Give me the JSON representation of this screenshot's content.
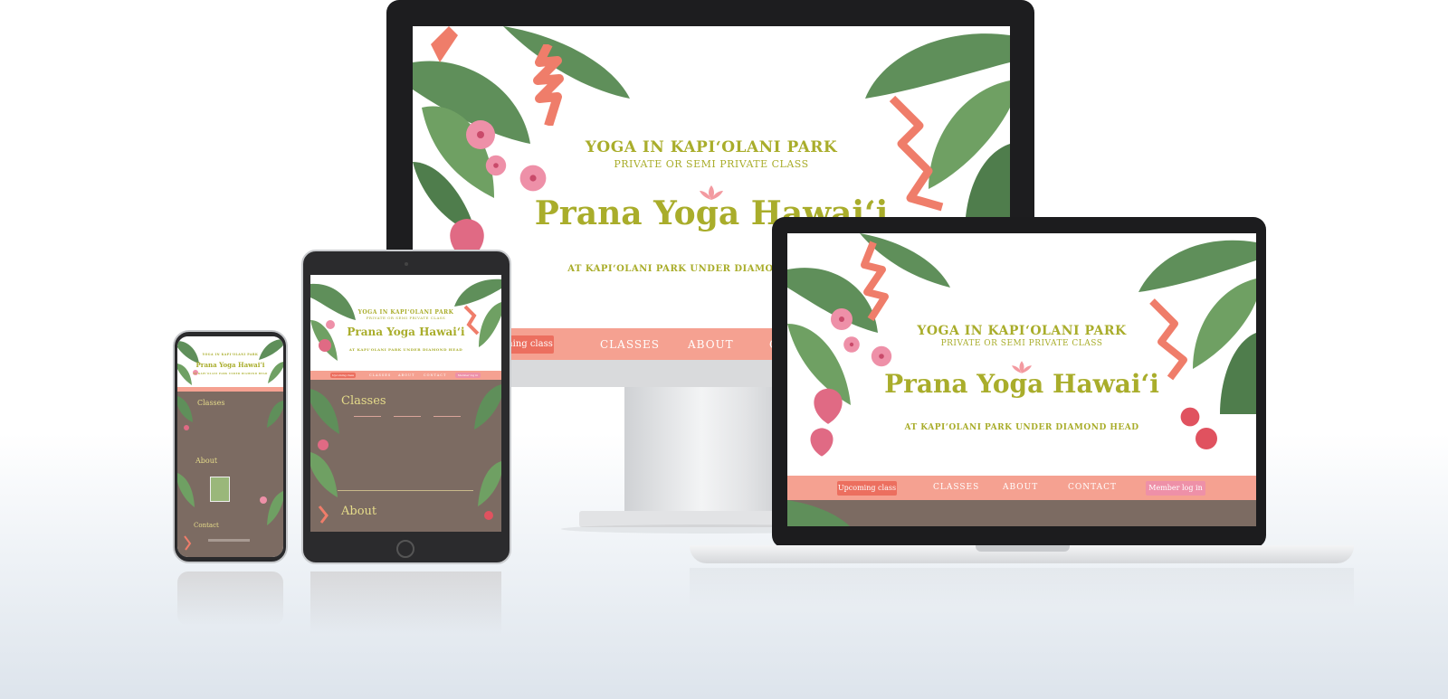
{
  "site": {
    "headline": "YOGA IN KAPI‘OLANI PARK",
    "subheadline": "PRIVATE OR SEMI PRIVATE CLASS",
    "brand": "Prana Yoga Hawai‘i",
    "tagline": "AT KAPI‘OLANI PARK UNDER DIAMOND HEAD",
    "monitor_tagline": "AT KAPI‘OLANI PARK UNDER DIAMO",
    "nav": {
      "upcoming": "Upcoming class",
      "monitor_upcoming": "ming class",
      "classes": "CLASSES",
      "about": "ABOUT",
      "contact": "CONTACT",
      "monitor_contact": "C",
      "member": "Member log in"
    },
    "sections": {
      "classes": "Classes",
      "about": "About",
      "contact": "Contact"
    }
  },
  "colors": {
    "olive": "#a9ad2b",
    "salmon": "#f5a191",
    "coral": "#ec6f5f",
    "pink": "#ee90a8",
    "taupe": "#7c6b62",
    "leaf": "#5f8f5a"
  },
  "decor": {
    "left_leaves": "banana-leaves-illustration",
    "right_leaves": "banana-leaves-illustration",
    "heliconia": "heliconia-flower-illustration",
    "hibiscus": "hibiscus-flower-illustration",
    "anthurium": "anthurium-flower-illustration",
    "lotus": "lotus-icon"
  }
}
